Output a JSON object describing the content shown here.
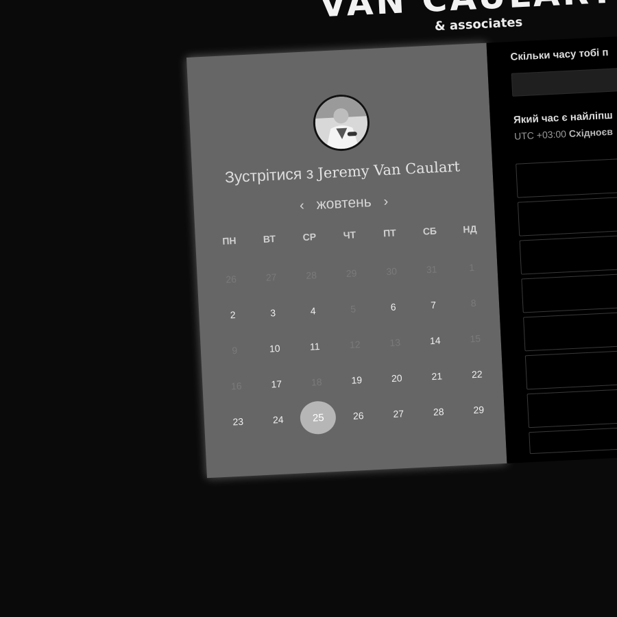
{
  "brand": {
    "title": "VAN CAULART",
    "subtitle": "& associates"
  },
  "calendar": {
    "meeting_prefix": "Зустрітися з",
    "host_name": "Jeremy Van Caulart",
    "month": "жовтень",
    "prev_label": "‹",
    "next_label": "›",
    "weekdays": [
      "ПН",
      "ВТ",
      "СР",
      "ЧТ",
      "ПТ",
      "СБ",
      "НД"
    ],
    "days": [
      {
        "d": "26",
        "s": "off"
      },
      {
        "d": "27",
        "s": "off"
      },
      {
        "d": "28",
        "s": "off"
      },
      {
        "d": "29",
        "s": "off"
      },
      {
        "d": "30",
        "s": "off"
      },
      {
        "d": "31",
        "s": "off"
      },
      {
        "d": "1",
        "s": "off"
      },
      {
        "d": "2",
        "s": "on"
      },
      {
        "d": "3",
        "s": "on"
      },
      {
        "d": "4",
        "s": "on"
      },
      {
        "d": "5",
        "s": "off"
      },
      {
        "d": "6",
        "s": "on"
      },
      {
        "d": "7",
        "s": "on"
      },
      {
        "d": "8",
        "s": "off"
      },
      {
        "d": "9",
        "s": "off"
      },
      {
        "d": "10",
        "s": "on"
      },
      {
        "d": "11",
        "s": "on"
      },
      {
        "d": "12",
        "s": "off"
      },
      {
        "d": "13",
        "s": "off"
      },
      {
        "d": "14",
        "s": "on"
      },
      {
        "d": "15",
        "s": "off"
      },
      {
        "d": "16",
        "s": "off"
      },
      {
        "d": "17",
        "s": "on"
      },
      {
        "d": "18",
        "s": "off"
      },
      {
        "d": "19",
        "s": "on"
      },
      {
        "d": "20",
        "s": "on"
      },
      {
        "d": "21",
        "s": "on"
      },
      {
        "d": "22",
        "s": "on"
      },
      {
        "d": "23",
        "s": "on"
      },
      {
        "d": "24",
        "s": "on"
      },
      {
        "d": "25",
        "s": "sel"
      },
      {
        "d": "26",
        "s": "on"
      },
      {
        "d": "27",
        "s": "on"
      },
      {
        "d": "28",
        "s": "on"
      },
      {
        "d": "29",
        "s": "on"
      }
    ]
  },
  "booking": {
    "duration_question": "Скільки часу тобі п",
    "time_question": "Який час є найліпш",
    "timezone_offset": "UTC +03:00",
    "timezone_name": "Східноєв",
    "slot_count": 8
  },
  "colors": {
    "background": "#0a0a0a",
    "calendar_panel": "#666666",
    "selected_day": "#b6b6b6",
    "right_panel": "#000000"
  }
}
